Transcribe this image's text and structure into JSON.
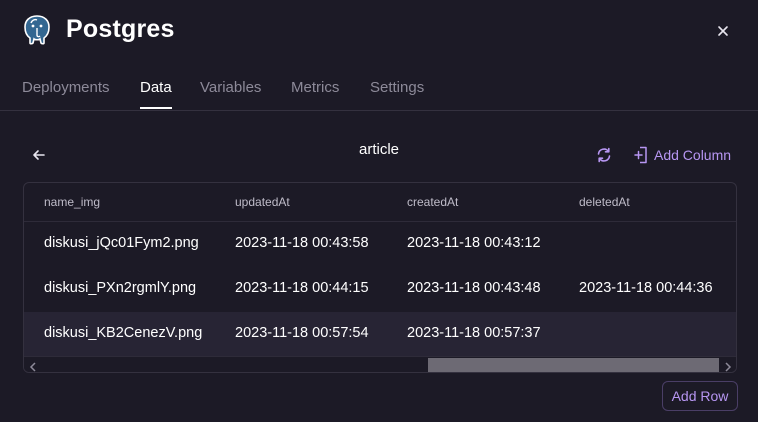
{
  "header": {
    "title": "Postgres",
    "logo_icon": "postgres-elephant-icon",
    "close_icon": "close-icon"
  },
  "tabs": [
    {
      "label": "Deployments",
      "active": false
    },
    {
      "label": "Data",
      "active": true
    },
    {
      "label": "Variables",
      "active": false
    },
    {
      "label": "Metrics",
      "active": false
    },
    {
      "label": "Settings",
      "active": false
    }
  ],
  "toolbar": {
    "back_icon": "arrow-left-icon",
    "table_name": "article",
    "refresh_icon": "refresh-icon",
    "add_column_label": "Add Column",
    "add_column_icon": "add-column-icon"
  },
  "table": {
    "columns": [
      "name_img",
      "updatedAt",
      "createdAt",
      "deletedAt"
    ],
    "rows": [
      [
        "diskusi_jQc01Fym2.png",
        "2023-11-18 00:43:58",
        "2023-11-18 00:43:12",
        ""
      ],
      [
        "diskusi_PXn2rgmlY.png",
        "2023-11-18 00:44:15",
        "2023-11-18 00:43:48",
        "2023-11-18 00:44:36"
      ],
      [
        "diskusi_KB2CenezV.png",
        "2023-11-18 00:57:54",
        "2023-11-18 00:57:37",
        ""
      ]
    ]
  },
  "footer": {
    "add_row_label": "Add Row"
  },
  "colors": {
    "background": "#1c1a26",
    "accent": "#b796f2",
    "border": "#34313f",
    "muted_text": "#8d8a99"
  }
}
